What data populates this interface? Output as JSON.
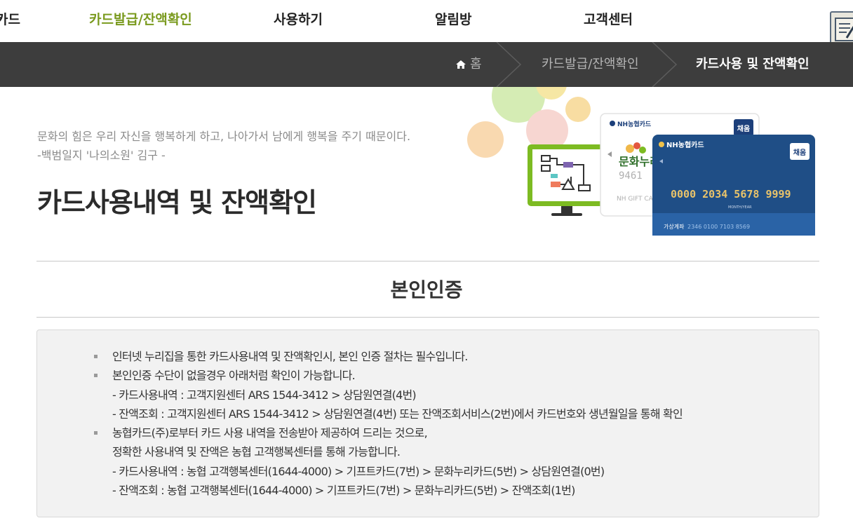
{
  "nav": {
    "items": [
      {
        "label": "카드"
      },
      {
        "label": "카드발급/잔액확인",
        "active": true
      },
      {
        "label": "사용하기"
      },
      {
        "label": "알림방"
      },
      {
        "label": "고객센터"
      }
    ],
    "active_color": "#7a9a1e"
  },
  "breadcrumb": {
    "home_label": "홈",
    "parent": "카드발급/잔액확인",
    "current": "카드사용 및 잔액확인",
    "bar_color": "#3d3d3d"
  },
  "hero": {
    "quote_line1": "문화의 힘은 우리 자신을 행복하게 하고, 나아가서 남에게 행복을 주기 때문이다.",
    "quote_line2": "-백범일지 '나의소원' 김구 -",
    "title": "카드사용내역 및 잔액확인",
    "card_back": {
      "brand": "NH농협카드",
      "badge": "채움",
      "logo_text": "문화누리",
      "number": "9461",
      "caption": "NH GIFT CA"
    },
    "card_front": {
      "brand": "NH농협카드",
      "badge": "채움",
      "number": "0000 2034 5678 9999",
      "expiry_label": "MONTH/YEAR",
      "account_label": "가상계좌",
      "account": "2346 0100 7103 8569"
    }
  },
  "section": {
    "title": "본인인증",
    "bullets": [
      {
        "lines": [
          "인터넷 누리집을 통한 카드사용내역 및 잔액확인시, 본인 인증 절차는 필수입니다."
        ]
      },
      {
        "lines": [
          "본인인증 수단이 없을경우 아래처럼 확인이 가능합니다.",
          "- 카드사용내역 : 고객지원센터 ARS 1544-3412 > 상담원연결(4번)",
          "- 잔액조회 : 고객지원센터 ARS 1544-3412 > 상담원연결(4번) 또는 잔액조회서비스(2번)에서 카드번호와 생년월일을 통해 확인"
        ]
      },
      {
        "lines": [
          "농협카드(주)로부터 카드 사용 내역을 전송받아 제공하여 드리는 것으로,",
          "정확한 사용내역 및 잔액은 농협 고객행복센터를 통해 가능합니다.",
          "- 카드사용내역 : 농협 고객행복센터(1644-4000) > 기프트카드(7번) > 문화누리카드(5번) > 상담원연결(0번)",
          "- 잔액조회 : 농협 고객행복센터(1644-4000) > 기프트카드(7번) > 문화누리카드(5번) > 잔액조회(1번)"
        ]
      }
    ]
  },
  "icons": {
    "home": "home-icon",
    "sitemap": "sitemap-icon",
    "monitor": "monitor-icon",
    "bullet": "square-bullet-icon"
  }
}
